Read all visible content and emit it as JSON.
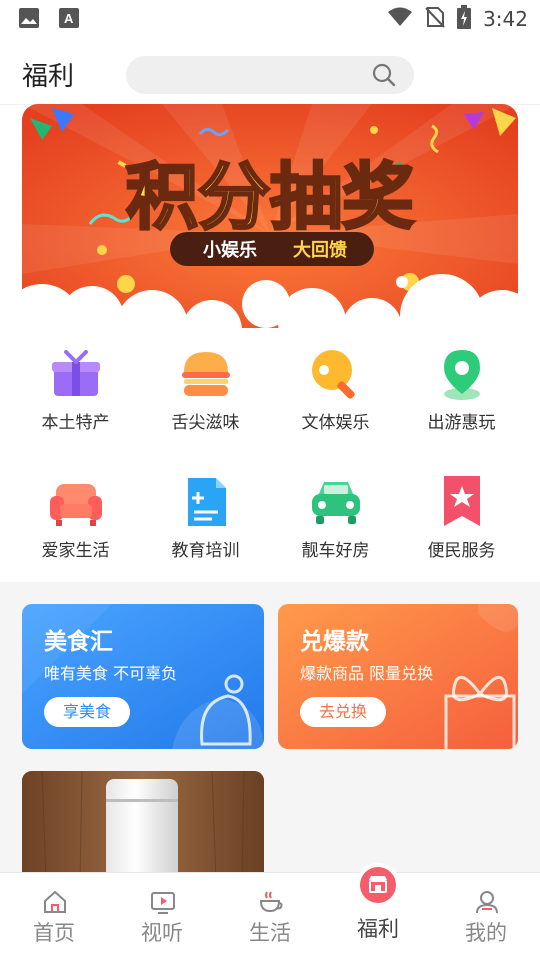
{
  "status_bar": {
    "time": "3:42"
  },
  "header": {
    "title": "福利",
    "search_placeholder": ""
  },
  "banner": {
    "headline": "积分抽奖",
    "tag_left": "小娱乐",
    "tag_right": "大回馈"
  },
  "categories": [
    {
      "label": "本土特产",
      "icon": "gift-icon"
    },
    {
      "label": "舌尖滋味",
      "icon": "burger-icon"
    },
    {
      "label": "文体娱乐",
      "icon": "ping-pong-icon"
    },
    {
      "label": "出游惠玩",
      "icon": "location-pin-icon"
    },
    {
      "label": "爱家生活",
      "icon": "sofa-icon"
    },
    {
      "label": "教育培训",
      "icon": "document-icon"
    },
    {
      "label": "靓车好房",
      "icon": "car-icon"
    },
    {
      "label": "便民服务",
      "icon": "bookmark-star-icon"
    }
  ],
  "promo_cards": [
    {
      "title": "美食汇",
      "subtitle": "唯有美食 不可辜负",
      "button": "享美食",
      "accent": "#2f8cf2"
    },
    {
      "title": "兑爆款",
      "subtitle": "爆款商品 限量兑换",
      "button": "去兑换",
      "accent": "#f6724a"
    }
  ],
  "bottom_nav": [
    {
      "label": "首页",
      "icon": "home-icon"
    },
    {
      "label": "视听",
      "icon": "video-icon"
    },
    {
      "label": "生活",
      "icon": "coffee-icon"
    },
    {
      "label": "福利",
      "icon": "shop-icon",
      "active": true
    },
    {
      "label": "我的",
      "icon": "user-icon"
    }
  ]
}
